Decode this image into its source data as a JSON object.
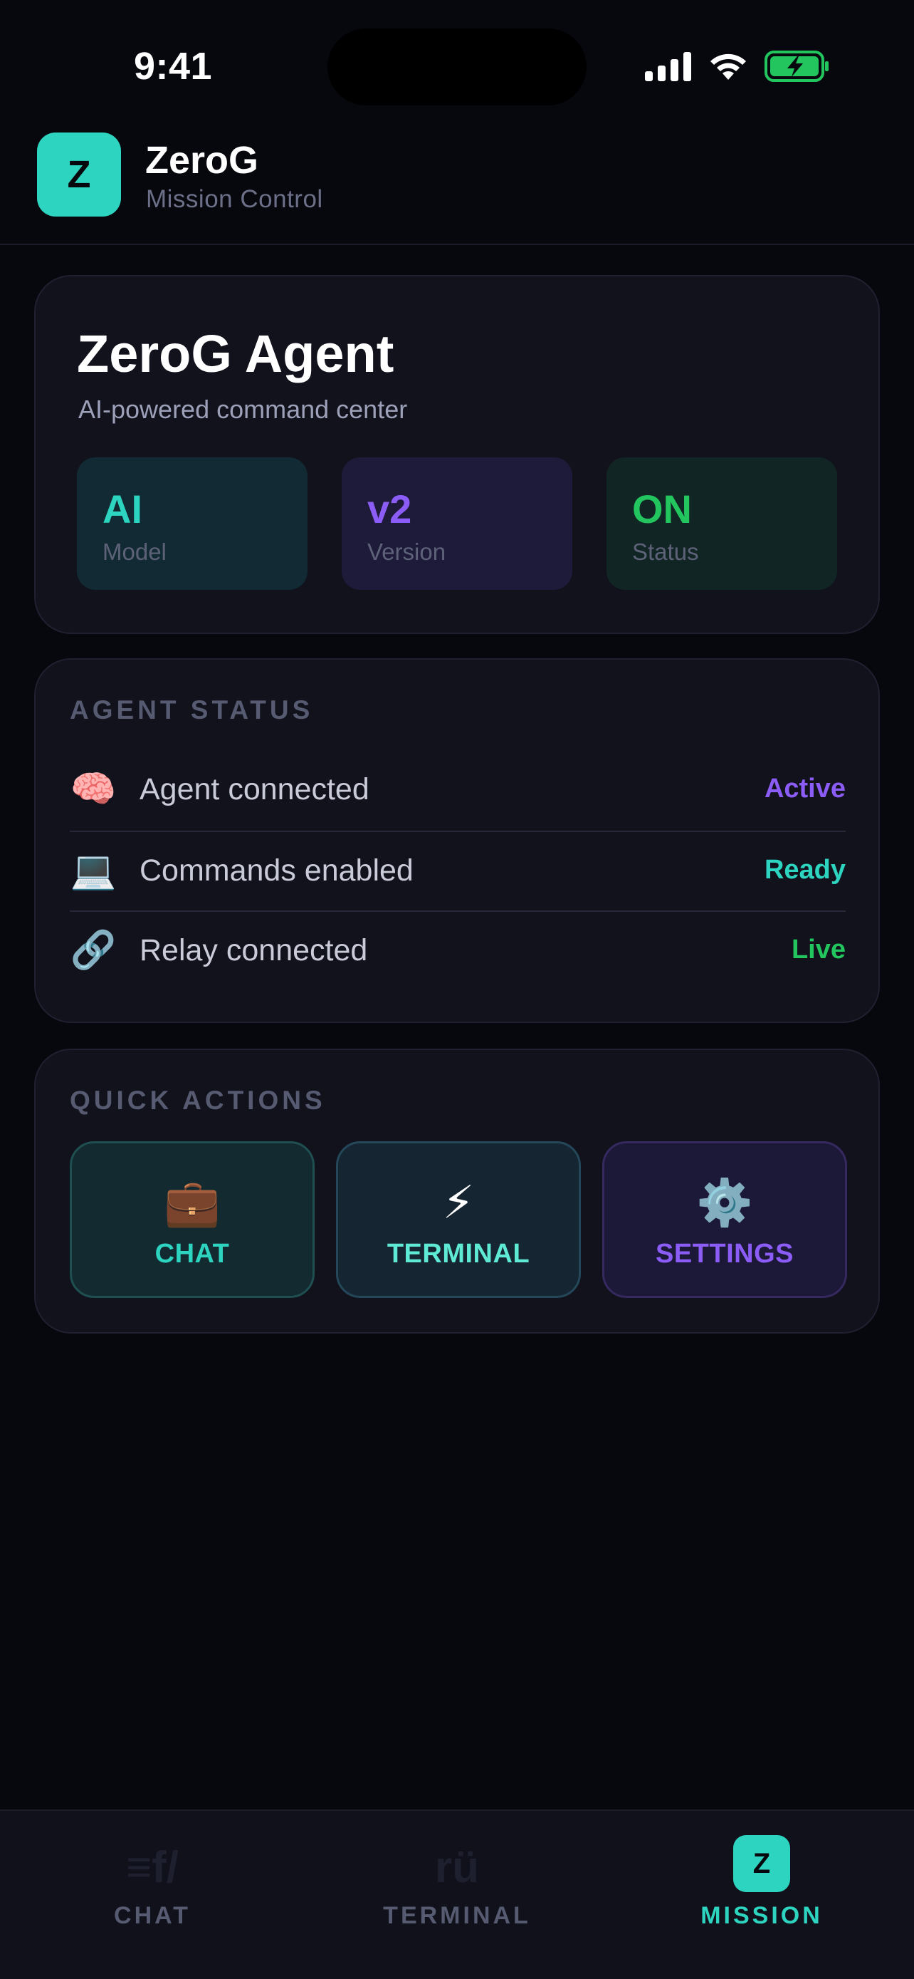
{
  "status_bar": {
    "time": "9:41",
    "icons": [
      "cellular-signal-icon",
      "wifi-icon",
      "battery-charging-icon"
    ]
  },
  "header": {
    "logo_letter": "Z",
    "app_name": "ZeroG",
    "subtitle": "Mission Control"
  },
  "hero": {
    "title": "ZeroG Agent",
    "subtitle": "AI-powered command center",
    "stats": [
      {
        "value": "AI",
        "label": "Model",
        "color": "#2dd4bf"
      },
      {
        "value": "v2",
        "label": "Version",
        "color": "#8b5cf6"
      },
      {
        "value": "ON",
        "label": "Status",
        "color": "#22c55e"
      }
    ]
  },
  "agent_status": {
    "title": "AGENT STATUS",
    "rows": [
      {
        "icon": "brain-icon",
        "emoji": "🧠",
        "label": "Agent connected",
        "value": "Active",
        "color": "#8b5cf6"
      },
      {
        "icon": "laptop-icon",
        "emoji": "💻",
        "label": "Commands enabled",
        "value": "Ready",
        "color": "#2dd4bf"
      },
      {
        "icon": "link-icon",
        "emoji": "🔗",
        "label": "Relay connected",
        "value": "Live",
        "color": "#22c55e"
      }
    ]
  },
  "quick_actions": {
    "title": "QUICK ACTIONS",
    "buttons": [
      {
        "icon": "briefcase-icon",
        "emoji": "💼",
        "label": "CHAT"
      },
      {
        "icon": "lightning-icon",
        "emoji": "⚡",
        "label": "TERMINAL"
      },
      {
        "icon": "gear-icon",
        "emoji": "⚙️",
        "label": "SETTINGS"
      }
    ]
  },
  "tab_bar": {
    "active": "MISSION",
    "tabs": [
      {
        "label": "CHAT",
        "icon_text": "≡f/"
      },
      {
        "label": "TERMINAL",
        "icon_text": "rü"
      },
      {
        "label": "MISSION",
        "icon_text": "Z"
      }
    ]
  },
  "colors": {
    "background": "#07070e",
    "card": "#11121c",
    "accent_teal": "#2dd4bf",
    "accent_purple": "#8b5cf6",
    "accent_green": "#22c55e"
  }
}
